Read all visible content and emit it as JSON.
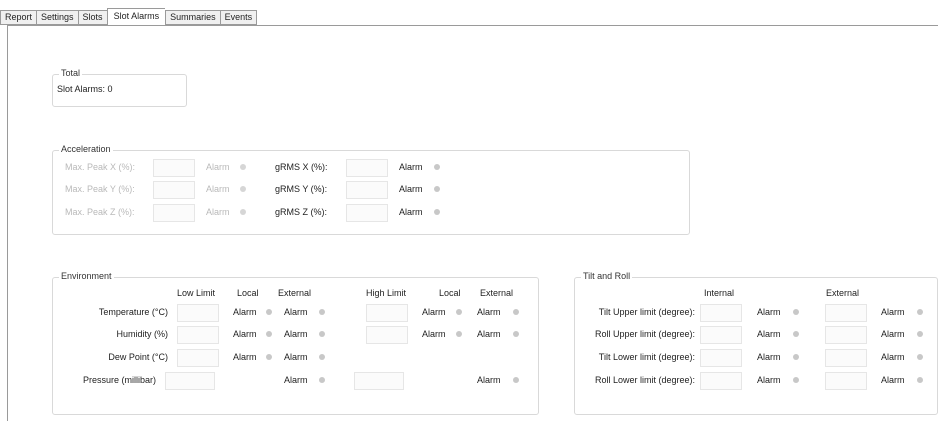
{
  "tabs": [
    "Report",
    "Settings",
    "Slots",
    "Slot Alarms",
    "Summaries",
    "Events"
  ],
  "active_tab": "Slot Alarms",
  "total": {
    "title": "Total",
    "slot_alarms": "Slot Alarms: 0"
  },
  "acceleration": {
    "title": "Acceleration",
    "rows": [
      {
        "peak_label": "Max. Peak X (%):",
        "alarm1": "Alarm",
        "grms_label": "gRMS X (%):",
        "alarm2": "Alarm"
      },
      {
        "peak_label": "Max. Peak Y (%):",
        "alarm1": "Alarm",
        "grms_label": "gRMS Y (%):",
        "alarm2": "Alarm"
      },
      {
        "peak_label": "Max. Peak Z (%):",
        "alarm1": "Alarm",
        "grms_label": "gRMS Z (%):",
        "alarm2": "Alarm"
      }
    ]
  },
  "environment": {
    "title": "Environment",
    "headers": {
      "low_limit": "Low Limit",
      "local1": "Local",
      "external1": "External",
      "high_limit": "High Limit",
      "local2": "Local",
      "external2": "External"
    },
    "rows": [
      {
        "label": "Temperature (°C)",
        "a1": "Alarm",
        "a2": "Alarm",
        "a3": "Alarm",
        "a4": "Alarm"
      },
      {
        "label": "Humidity (%)",
        "a1": "Alarm",
        "a2": "Alarm",
        "a3": "Alarm",
        "a4": "Alarm"
      },
      {
        "label": "Dew Point (°C)",
        "a1": "Alarm",
        "a2": "Alarm"
      },
      {
        "label": "Pressure (millibar)",
        "a2": "Alarm",
        "a4": "Alarm"
      }
    ]
  },
  "tilt": {
    "title": "Tilt and Roll",
    "headers": {
      "internal": "Internal",
      "external": "External"
    },
    "rows": [
      {
        "label": "Tilt Upper limit (degree):",
        "a1": "Alarm",
        "a2": "Alarm"
      },
      {
        "label": "Roll Upper limit (degree):",
        "a1": "Alarm",
        "a2": "Alarm"
      },
      {
        "label": "Tilt Lower limit (degree):",
        "a1": "Alarm",
        "a2": "Alarm"
      },
      {
        "label": "Roll Lower limit (degree):",
        "a1": "Alarm",
        "a2": "Alarm"
      }
    ]
  }
}
